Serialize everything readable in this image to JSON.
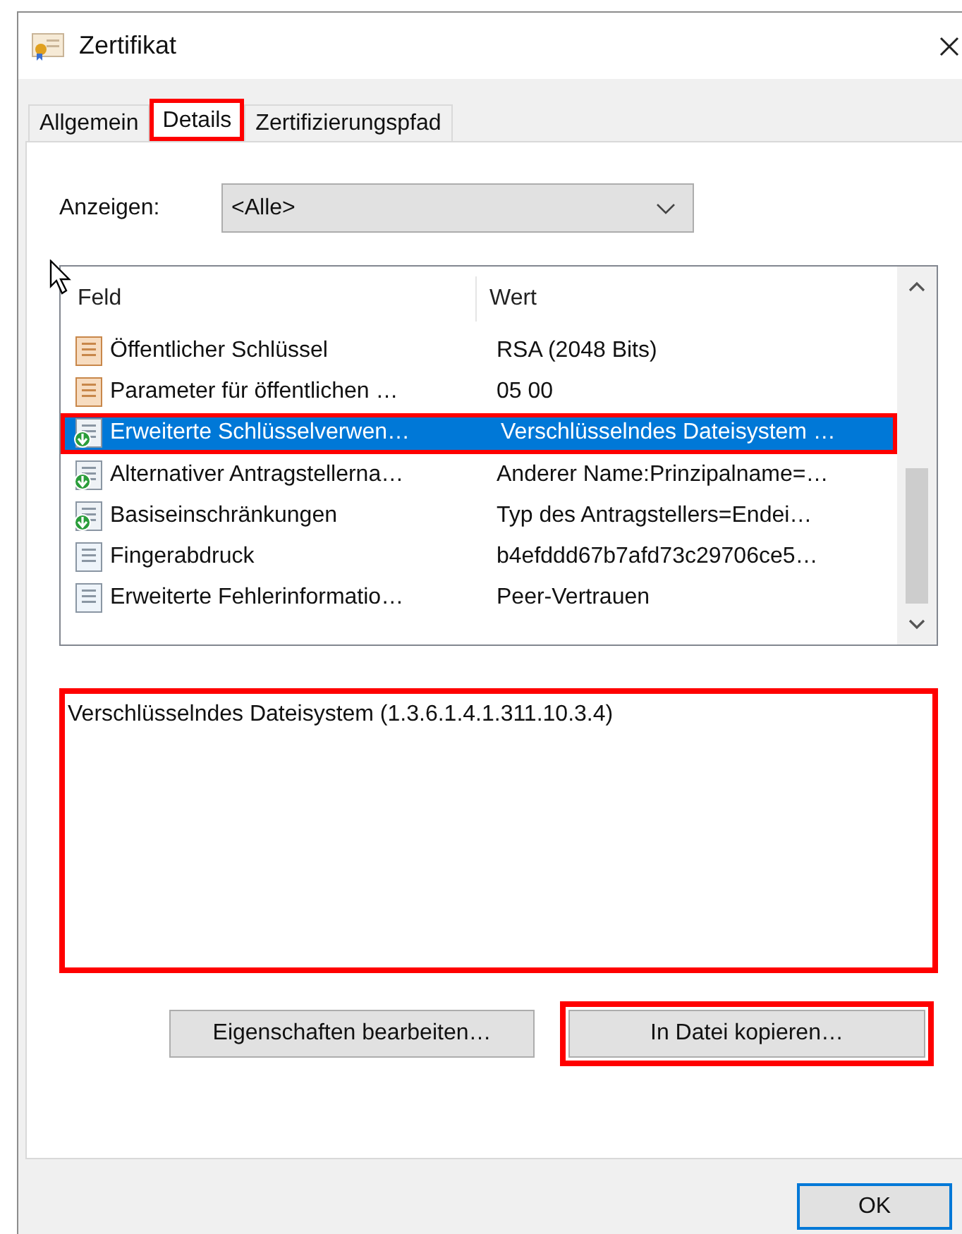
{
  "window": {
    "title": "Zertifikat"
  },
  "tabs": [
    {
      "label": "Allgemein",
      "selected": false,
      "highlighted": false
    },
    {
      "label": "Details",
      "selected": true,
      "highlighted": true
    },
    {
      "label": "Zertifizierungspfad",
      "selected": false,
      "highlighted": false
    }
  ],
  "show": {
    "label": "Anzeigen:",
    "value": "<Alle>"
  },
  "fields": {
    "columns": [
      "Feld",
      "Wert"
    ],
    "rows": [
      {
        "kind": "property",
        "field": "Öffentlicher Schlüssel",
        "value": "RSA (2048 Bits)",
        "selected": false,
        "highlighted": false
      },
      {
        "kind": "property",
        "field": "Parameter für öffentlichen …",
        "value": "05 00",
        "selected": false,
        "highlighted": false
      },
      {
        "kind": "extension",
        "field": "Erweiterte Schlüsselverwen…",
        "value": "Verschlüsselndes Dateisystem …",
        "selected": true,
        "highlighted": true
      },
      {
        "kind": "extension",
        "field": "Alternativer Antragstellerna…",
        "value": "Anderer Name:Prinzipalname=…",
        "selected": false,
        "highlighted": false
      },
      {
        "kind": "extension",
        "field": "Basiseinschränkungen",
        "value": "Typ des Antragstellers=Endei…",
        "selected": false,
        "highlighted": false
      },
      {
        "kind": "field",
        "field": "Fingerabdruck",
        "value": "b4efddd67b7afd73c29706ce5…",
        "selected": false,
        "highlighted": false
      },
      {
        "kind": "field",
        "field": "Erweiterte Fehlerinformatio…",
        "value": "Peer-Vertrauen",
        "selected": false,
        "highlighted": false
      }
    ]
  },
  "detail": {
    "value": "Verschlüsselndes Dateisystem (1.3.6.1.4.1.311.10.3.4)",
    "highlighted": true
  },
  "buttons": [
    {
      "label": "Eigenschaften bearbeiten…",
      "highlighted": false
    },
    {
      "label": "In Datei kopieren…",
      "highlighted": true
    }
  ],
  "footer_buttons": [
    {
      "label": "OK",
      "default": true
    }
  ]
}
